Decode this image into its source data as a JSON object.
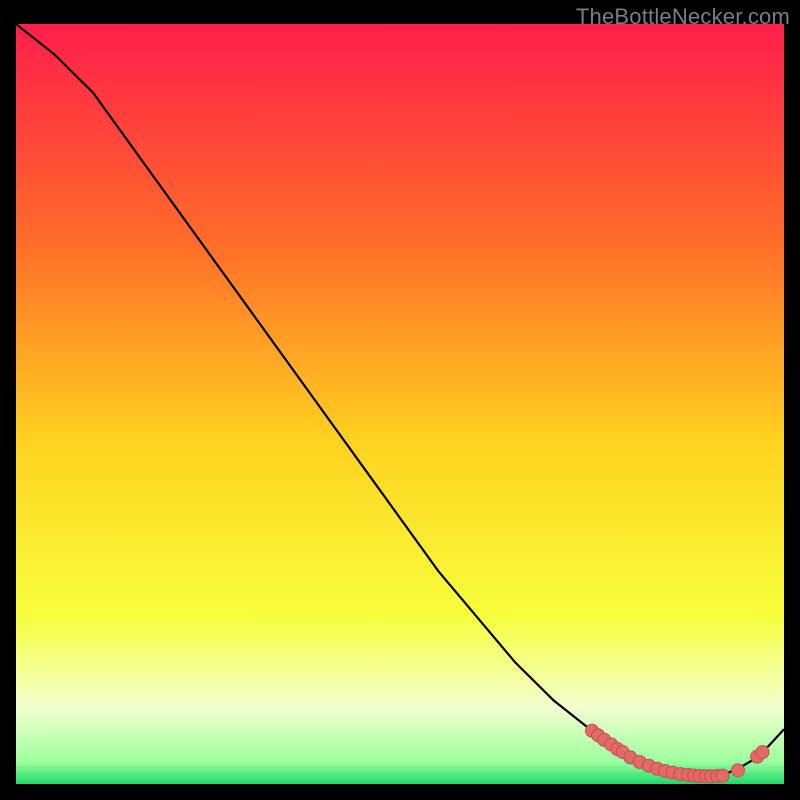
{
  "watermark": "TheBottleNecker.com",
  "colors": {
    "bg": "#000000",
    "grad_top": "#ff1e4b",
    "grad_mid_upper": "#ff6a2a",
    "grad_mid": "#ffd21f",
    "grad_lower": "#f7ff3d",
    "grad_lowband": "#f3ffd0",
    "grad_green": "#1fd96b",
    "curve": "#000000",
    "marker_fill": "#e46a6a",
    "marker_stroke": "#c24d4d"
  },
  "chart_data": {
    "type": "line",
    "title": "",
    "xlabel": "",
    "ylabel": "",
    "xlim": [
      0,
      100
    ],
    "ylim": [
      0,
      100
    ],
    "x": [
      0,
      5,
      10,
      15,
      20,
      25,
      30,
      35,
      40,
      45,
      50,
      55,
      60,
      65,
      70,
      75,
      78,
      80,
      82,
      84,
      86,
      88,
      90,
      92,
      94,
      96,
      98,
      100
    ],
    "y": [
      100,
      96,
      91,
      84,
      77,
      70,
      63,
      56,
      49,
      42,
      35,
      28,
      22,
      16,
      11,
      7,
      5,
      3.5,
      2.5,
      1.8,
      1.3,
      1.0,
      1.0,
      1.2,
      2.0,
      3.2,
      5.0,
      7.2
    ],
    "markers_x": [
      75.0,
      75.8,
      76.6,
      77.5,
      78.3,
      79.0,
      80.0,
      81.2,
      82.4,
      83.5,
      84.5,
      85.5,
      86.5,
      87.5,
      88.3,
      89.0,
      89.8,
      90.5,
      91.3,
      92.0,
      94.0,
      96.5,
      97.2
    ],
    "markers_y": [
      7.0,
      6.4,
      5.8,
      5.2,
      4.6,
      4.2,
      3.5,
      2.9,
      2.4,
      2.0,
      1.7,
      1.5,
      1.3,
      1.2,
      1.1,
      1.05,
      1.02,
      1.0,
      1.05,
      1.1,
      1.8,
      3.6,
      4.2
    ]
  }
}
